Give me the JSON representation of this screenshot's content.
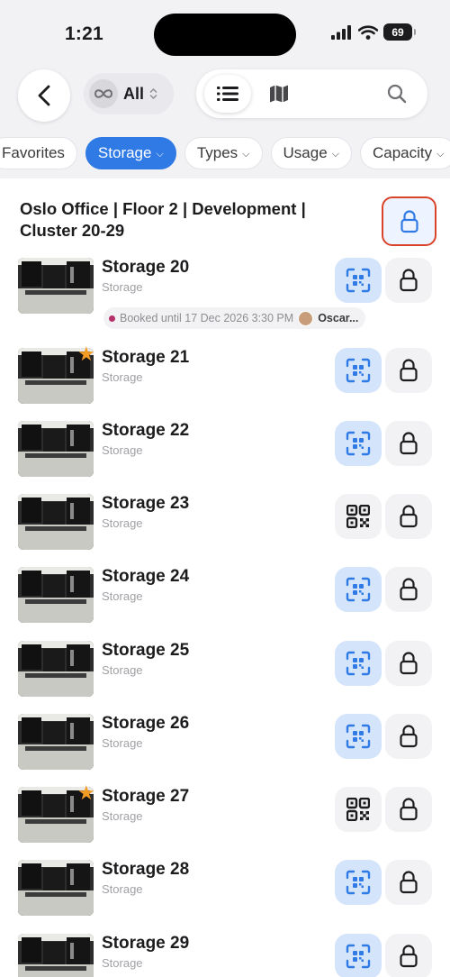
{
  "status": {
    "time": "1:21",
    "battery": "69"
  },
  "nav": {
    "scope_label": "All"
  },
  "filters": [
    {
      "label": "Favorites",
      "active": false
    },
    {
      "label": "Storage",
      "active": true
    },
    {
      "label": "Types",
      "active": false
    },
    {
      "label": "Usage",
      "active": false
    },
    {
      "label": "Capacity",
      "active": false
    }
  ],
  "cluster": {
    "title": "Oslo Office | Floor 2 | Development | Cluster 20-29"
  },
  "rows": [
    {
      "title": "Storage 20",
      "subtitle": "Storage",
      "favorite": false,
      "qr_style": "scan"
    },
    {
      "title": "Storage 21",
      "subtitle": "Storage",
      "favorite": true,
      "qr_style": "scan"
    },
    {
      "title": "Storage 22",
      "subtitle": "Storage",
      "favorite": false,
      "qr_style": "scan"
    },
    {
      "title": "Storage 23",
      "subtitle": "Storage",
      "favorite": false,
      "qr_style": "code"
    },
    {
      "title": "Storage 24",
      "subtitle": "Storage",
      "favorite": false,
      "qr_style": "scan"
    },
    {
      "title": "Storage 25",
      "subtitle": "Storage",
      "favorite": false,
      "qr_style": "scan"
    },
    {
      "title": "Storage 26",
      "subtitle": "Storage",
      "favorite": false,
      "qr_style": "scan"
    },
    {
      "title": "Storage 27",
      "subtitle": "Storage",
      "favorite": true,
      "qr_style": "code"
    },
    {
      "title": "Storage 28",
      "subtitle": "Storage",
      "favorite": false,
      "qr_style": "scan"
    },
    {
      "title": "Storage 29",
      "subtitle": "Storage",
      "favorite": false,
      "qr_style": "scan"
    }
  ],
  "booking": {
    "text": "Booked until 17 Dec 2026 3:30 PM",
    "person": "Oscar..."
  },
  "colors": {
    "accent": "#2f7ae5",
    "highlight_border": "#d9432a",
    "favorite": "#f39c25",
    "booking_dot": "#b5316b"
  }
}
